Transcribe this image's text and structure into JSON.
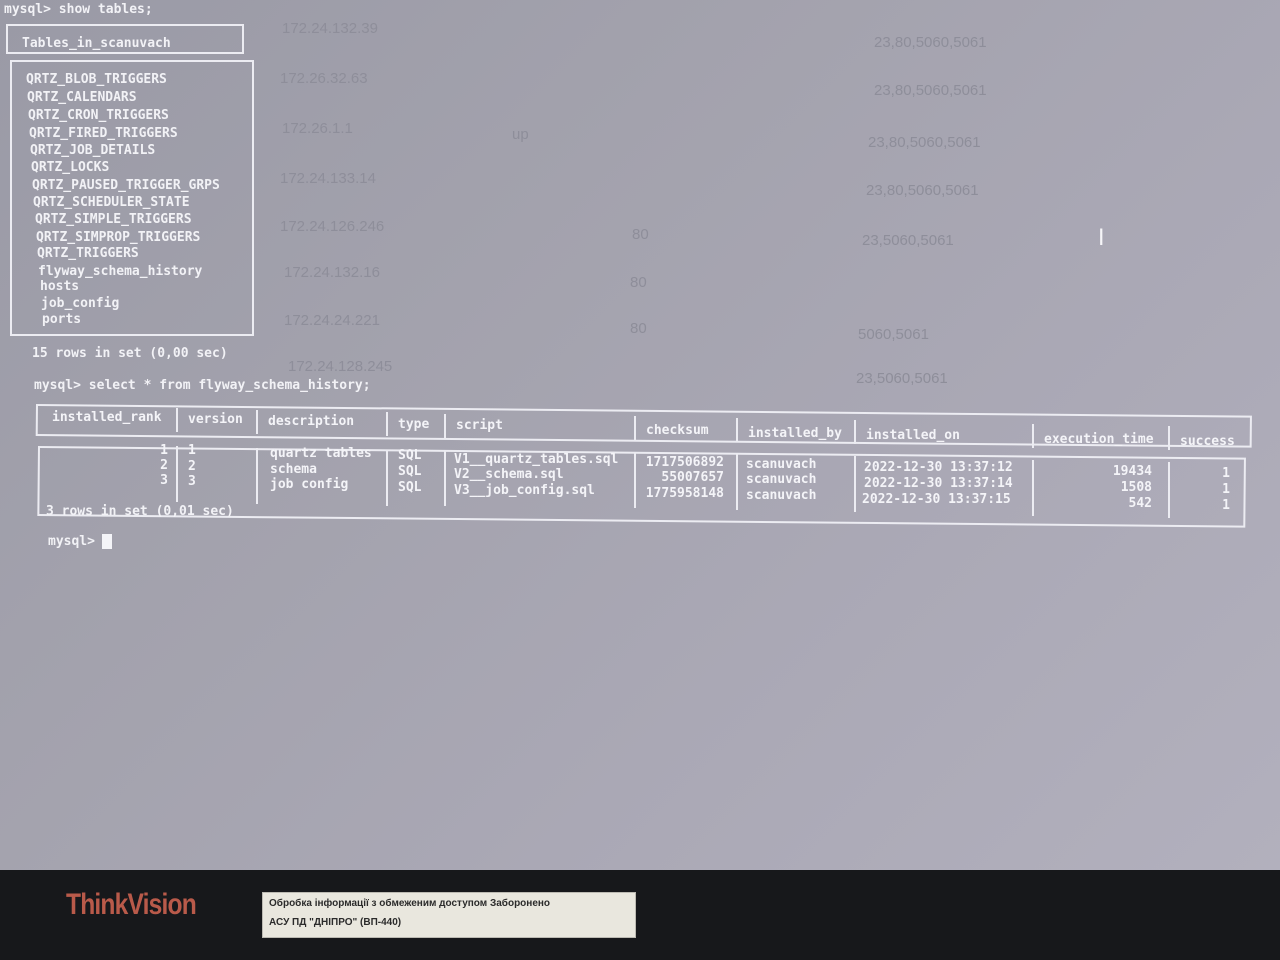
{
  "terminal": {
    "prompt1": "mysql> show tables;",
    "tables_header": "Tables_in_scanuvach",
    "tables": [
      "QRTZ_BLOB_TRIGGERS",
      "QRTZ_CALENDARS",
      "QRTZ_CRON_TRIGGERS",
      "QRTZ_FIRED_TRIGGERS",
      "QRTZ_JOB_DETAILS",
      "QRTZ_LOCKS",
      "QRTZ_PAUSED_TRIGGER_GRPS",
      "QRTZ_SCHEDULER_STATE",
      "QRTZ_SIMPLE_TRIGGERS",
      "QRTZ_SIMPROP_TRIGGERS",
      "QRTZ_TRIGGERS",
      "flyway_schema_history",
      "hosts",
      "job_config",
      "ports"
    ],
    "tables_summary": "15 rows in set (0,00 sec)",
    "prompt2": "mysql> select * from flyway_schema_history;",
    "history_headers": [
      "installed_rank",
      "version",
      "description",
      "type",
      "script",
      "checksum",
      "installed_by",
      "installed_on",
      "execution_time",
      "success"
    ],
    "history_rows": [
      [
        "1",
        "1",
        "quartz tables",
        "SQL",
        "V1__quartz_tables.sql",
        "1717506892",
        "scanuvach",
        "2022-12-30 13:37:12",
        "19434",
        "1"
      ],
      [
        "2",
        "2",
        "schema",
        "SQL",
        "V2__schema.sql",
        "55007657",
        "scanuvach",
        "2022-12-30 13:37:14",
        "1508",
        "1"
      ],
      [
        "3",
        "3",
        "job config",
        "SQL",
        "V3__job_config.sql",
        "1775958148",
        "scanuvach",
        "2022-12-30 13:37:15",
        "542",
        "1"
      ]
    ],
    "history_summary": "3 rows in set (0,01 sec)",
    "prompt3": "mysql>"
  },
  "background_ghost": [
    "172.24.132.39",
    "23,80,5060,5061",
    "172.26.32.63",
    "23,80,5060,5061",
    "172.26.1.1",
    "up",
    "23,80,5060,5061",
    "172.24.133.14",
    "23,80,5060,5061",
    "172.24.126.246",
    "80",
    "23,5060,5061",
    "172.24.132.16",
    "80",
    "172.24.24.221",
    "80",
    "5060,5061",
    "172.24.128.245",
    "23,5060,5061"
  ],
  "monitor": {
    "brand": "ThinkVision",
    "sticker_line1": "Обробка інформації з обмеженим доступом Заборонено",
    "sticker_line2": "АСУ ПД \"ДНІПРО\" (ВП-440)"
  }
}
